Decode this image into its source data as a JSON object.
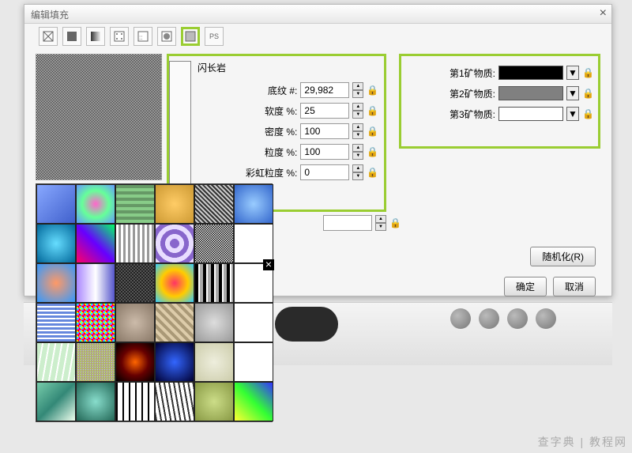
{
  "dialog": {
    "title": "编辑填充",
    "close": "×"
  },
  "pattern_name": "闪长岩",
  "fields": {
    "base_label": "底纹 #:",
    "base_value": "29,982",
    "softness_label": "软度 %:",
    "softness_value": "25",
    "density_label": "密度 %:",
    "density_value": "100",
    "grain_label": "粒度 %:",
    "grain_value": "100",
    "rainbow_label": "彩虹粒度 %:",
    "rainbow_value": "0"
  },
  "minerals": {
    "m1_label": "第1矿物质:",
    "m1_color": "#000000",
    "m2_label": "第2矿物质:",
    "m2_color": "#808080",
    "m3_label": "第3矿物质:",
    "m3_color": "#FFFFFF"
  },
  "buttons": {
    "randomize": "随机化(R)",
    "ok": "确定",
    "cancel": "取消"
  },
  "toolbar_icons": [
    "none",
    "solid",
    "gradient",
    "pattern",
    "ps-pattern",
    "bitmap",
    "texture",
    "postscript"
  ],
  "watermark": "查字典 | 教程网",
  "palette_colors": [
    "linear-gradient(135deg,#88a8ff,#4060cc)",
    "radial-gradient(circle,#ff66cc,#66ff99,#6699ff)",
    "repeating-linear-gradient(0deg,#88cc88 0 4px,#669966 4px 8px)",
    "radial-gradient(circle,#ffcc66,#cc9933)",
    "repeating-linear-gradient(45deg,#333 0 2px,#ccc 2px 4px)",
    "radial-gradient(circle,#99ccff,#3366cc)",
    "radial-gradient(circle,#66ddff,#006699)",
    "linear-gradient(45deg,#ff0066,#6600ff,#00ff66)",
    "repeating-linear-gradient(90deg,#fff 0 3px,#999 3px 6px)",
    "repeating-radial-gradient(circle,#8866cc 0 6px,#e8ddff 6px 12px)",
    "repeating-conic-gradient(#000 0 25%,#fff 0 50%) 0/3px 3px",
    "",
    "radial-gradient(circle,#ff9966,#3399ff)",
    "linear-gradient(90deg,#aa88ff,#ffffff,#5555cc)",
    "repeating-conic-gradient(#222 0 25%,#555 0 50%) 0/4px 4px",
    "radial-gradient(circle,#ff3366,#ffcc00,#33ccff)",
    "repeating-linear-gradient(90deg,#000 0 4px,#fff 4px 6px,#aaa 6px 10px)",
    "",
    "repeating-linear-gradient(0deg,#6688dd 0 3px,#fff 3px 5px)",
    "repeating-conic-gradient(#f0f 0 12%,#0ff 0 25%,#ff0 0 37%,#f00 0 50%) 0/6px 6px",
    "radial-gradient(ellipse,#ccbbaa,#887766)",
    "repeating-linear-gradient(45deg,#ddccaa 0 4px,#aa9977 4px 8px)",
    "radial-gradient(circle,#ddd,#999)",
    "",
    "repeating-linear-gradient(100deg,#cceecc 0 6px,#fff 6px 8px)",
    "repeating-conic-gradient(#f66 0 10%,#6f6 0 20%,#66f 0 30%,#ff6 0 40%) 0/3px 3px",
    "radial-gradient(circle,#ff6600,#660000,#000)",
    "radial-gradient(circle,#3366ff,#000033)",
    "radial-gradient(circle,#eeeedd,#ccccaa)",
    "",
    "linear-gradient(135deg,#77ccaa,#338877,#eeffee)",
    "radial-gradient(circle,#88ddcc,#226655)",
    "repeating-linear-gradient(90deg,#000 0 2px,#fff 2px 8px)",
    "repeating-linear-gradient(80deg,#333 0 2px,#fff 2px 6px)",
    "radial-gradient(circle,#ccdd88,#889944)",
    "linear-gradient(45deg,#ffff33,#33ff33,#3333ff)"
  ]
}
